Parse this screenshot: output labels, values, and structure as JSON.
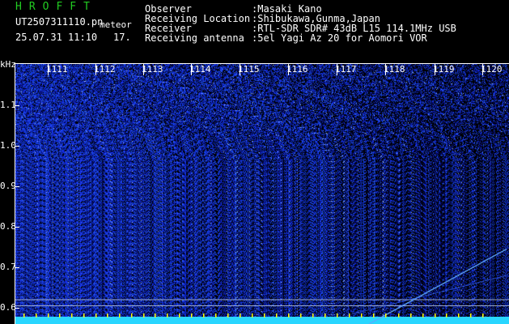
{
  "header": {
    "brand": "HROFFT",
    "file_name": "UT2507311110.pn",
    "file_suffix": "meteor",
    "date_time": "25.07.31 11:10",
    "minute_count": "17.",
    "info_labels": [
      "Observer",
      "Receiving Location",
      "Receiver",
      "Receiving antenna"
    ],
    "info_values": [
      ":Masaki Kano",
      ":Shibukawa,Gunma,Japan",
      ":RTL-SDR SDR# 43dB L15 114.1MHz USB",
      ":5el Yagi Az 20 for Aomori VOR"
    ]
  },
  "axis": {
    "y_unit": "kHz",
    "y_ticks": [
      "1.1",
      "1.0",
      "0.9",
      "0.8",
      "0.7",
      "0.6"
    ],
    "x_ticks": [
      "1111",
      "1112",
      "1113",
      "1114",
      "1115",
      "1116",
      "1117",
      "1118",
      "1119",
      "1120"
    ]
  },
  "colors": {
    "background": "#000000",
    "noise": "#1f3dff",
    "header_text": "#ffffff",
    "brand_green": "#22cc22",
    "bottom_strip": "#29d6ff",
    "yellow_marker": "#ffff00"
  },
  "chart_data": {
    "type": "heatmap",
    "title": "",
    "xlabel": "",
    "ylabel": "kHz",
    "y_range_khz": [
      0.56,
      1.2
    ],
    "x_tick_labels": [
      "1111",
      "1112",
      "1113",
      "1114",
      "1115",
      "1116",
      "1117",
      "1118",
      "1119",
      "1120"
    ],
    "y_tick_values_khz": [
      1.1,
      1.0,
      0.9,
      0.8,
      0.7,
      0.6
    ],
    "horizontal_lines_khz": [
      0.62,
      0.605
    ],
    "meteor_trail": {
      "start_khz": 0.56,
      "end_khz": 0.745,
      "start_tick": "1118",
      "end_tick": "1120"
    }
  }
}
